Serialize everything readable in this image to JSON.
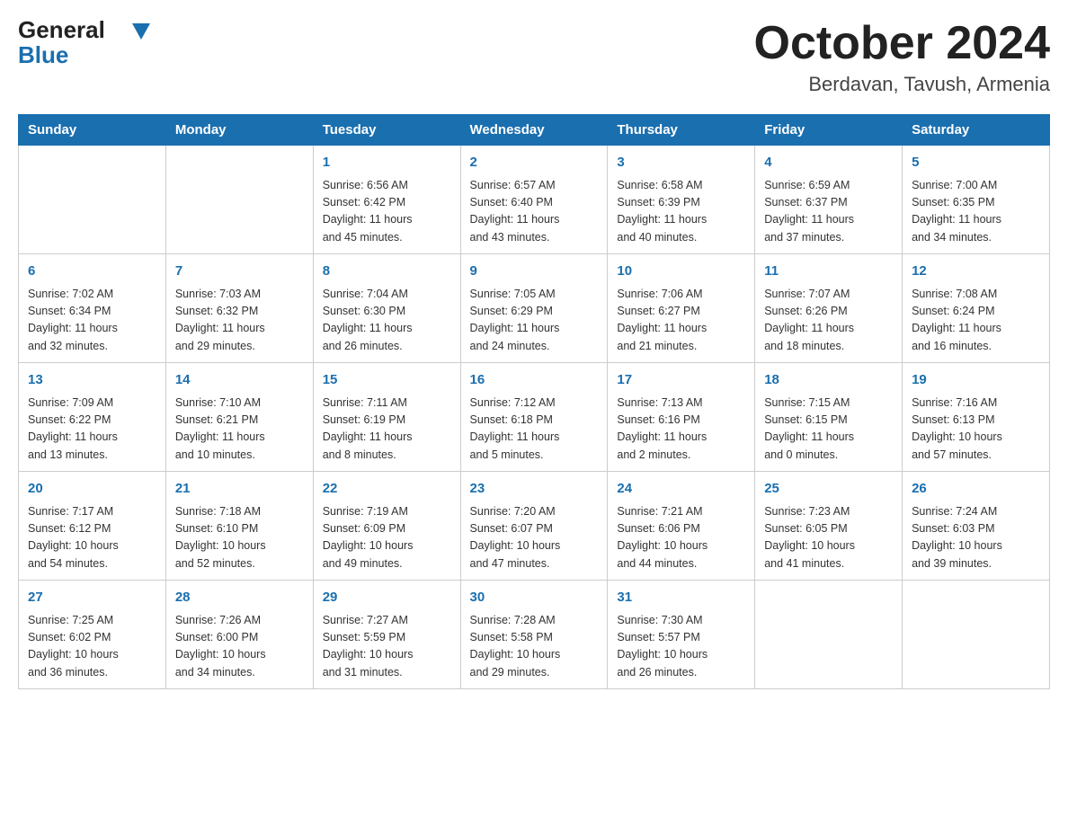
{
  "header": {
    "logo_line1": "General",
    "logo_line2": "Blue",
    "month_title": "October 2024",
    "location": "Berdavan, Tavush, Armenia"
  },
  "weekdays": [
    "Sunday",
    "Monday",
    "Tuesday",
    "Wednesday",
    "Thursday",
    "Friday",
    "Saturday"
  ],
  "weeks": [
    [
      {
        "day": "",
        "info": ""
      },
      {
        "day": "",
        "info": ""
      },
      {
        "day": "1",
        "info": "Sunrise: 6:56 AM\nSunset: 6:42 PM\nDaylight: 11 hours\nand 45 minutes."
      },
      {
        "day": "2",
        "info": "Sunrise: 6:57 AM\nSunset: 6:40 PM\nDaylight: 11 hours\nand 43 minutes."
      },
      {
        "day": "3",
        "info": "Sunrise: 6:58 AM\nSunset: 6:39 PM\nDaylight: 11 hours\nand 40 minutes."
      },
      {
        "day": "4",
        "info": "Sunrise: 6:59 AM\nSunset: 6:37 PM\nDaylight: 11 hours\nand 37 minutes."
      },
      {
        "day": "5",
        "info": "Sunrise: 7:00 AM\nSunset: 6:35 PM\nDaylight: 11 hours\nand 34 minutes."
      }
    ],
    [
      {
        "day": "6",
        "info": "Sunrise: 7:02 AM\nSunset: 6:34 PM\nDaylight: 11 hours\nand 32 minutes."
      },
      {
        "day": "7",
        "info": "Sunrise: 7:03 AM\nSunset: 6:32 PM\nDaylight: 11 hours\nand 29 minutes."
      },
      {
        "day": "8",
        "info": "Sunrise: 7:04 AM\nSunset: 6:30 PM\nDaylight: 11 hours\nand 26 minutes."
      },
      {
        "day": "9",
        "info": "Sunrise: 7:05 AM\nSunset: 6:29 PM\nDaylight: 11 hours\nand 24 minutes."
      },
      {
        "day": "10",
        "info": "Sunrise: 7:06 AM\nSunset: 6:27 PM\nDaylight: 11 hours\nand 21 minutes."
      },
      {
        "day": "11",
        "info": "Sunrise: 7:07 AM\nSunset: 6:26 PM\nDaylight: 11 hours\nand 18 minutes."
      },
      {
        "day": "12",
        "info": "Sunrise: 7:08 AM\nSunset: 6:24 PM\nDaylight: 11 hours\nand 16 minutes."
      }
    ],
    [
      {
        "day": "13",
        "info": "Sunrise: 7:09 AM\nSunset: 6:22 PM\nDaylight: 11 hours\nand 13 minutes."
      },
      {
        "day": "14",
        "info": "Sunrise: 7:10 AM\nSunset: 6:21 PM\nDaylight: 11 hours\nand 10 minutes."
      },
      {
        "day": "15",
        "info": "Sunrise: 7:11 AM\nSunset: 6:19 PM\nDaylight: 11 hours\nand 8 minutes."
      },
      {
        "day": "16",
        "info": "Sunrise: 7:12 AM\nSunset: 6:18 PM\nDaylight: 11 hours\nand 5 minutes."
      },
      {
        "day": "17",
        "info": "Sunrise: 7:13 AM\nSunset: 6:16 PM\nDaylight: 11 hours\nand 2 minutes."
      },
      {
        "day": "18",
        "info": "Sunrise: 7:15 AM\nSunset: 6:15 PM\nDaylight: 11 hours\nand 0 minutes."
      },
      {
        "day": "19",
        "info": "Sunrise: 7:16 AM\nSunset: 6:13 PM\nDaylight: 10 hours\nand 57 minutes."
      }
    ],
    [
      {
        "day": "20",
        "info": "Sunrise: 7:17 AM\nSunset: 6:12 PM\nDaylight: 10 hours\nand 54 minutes."
      },
      {
        "day": "21",
        "info": "Sunrise: 7:18 AM\nSunset: 6:10 PM\nDaylight: 10 hours\nand 52 minutes."
      },
      {
        "day": "22",
        "info": "Sunrise: 7:19 AM\nSunset: 6:09 PM\nDaylight: 10 hours\nand 49 minutes."
      },
      {
        "day": "23",
        "info": "Sunrise: 7:20 AM\nSunset: 6:07 PM\nDaylight: 10 hours\nand 47 minutes."
      },
      {
        "day": "24",
        "info": "Sunrise: 7:21 AM\nSunset: 6:06 PM\nDaylight: 10 hours\nand 44 minutes."
      },
      {
        "day": "25",
        "info": "Sunrise: 7:23 AM\nSunset: 6:05 PM\nDaylight: 10 hours\nand 41 minutes."
      },
      {
        "day": "26",
        "info": "Sunrise: 7:24 AM\nSunset: 6:03 PM\nDaylight: 10 hours\nand 39 minutes."
      }
    ],
    [
      {
        "day": "27",
        "info": "Sunrise: 7:25 AM\nSunset: 6:02 PM\nDaylight: 10 hours\nand 36 minutes."
      },
      {
        "day": "28",
        "info": "Sunrise: 7:26 AM\nSunset: 6:00 PM\nDaylight: 10 hours\nand 34 minutes."
      },
      {
        "day": "29",
        "info": "Sunrise: 7:27 AM\nSunset: 5:59 PM\nDaylight: 10 hours\nand 31 minutes."
      },
      {
        "day": "30",
        "info": "Sunrise: 7:28 AM\nSunset: 5:58 PM\nDaylight: 10 hours\nand 29 minutes."
      },
      {
        "day": "31",
        "info": "Sunrise: 7:30 AM\nSunset: 5:57 PM\nDaylight: 10 hours\nand 26 minutes."
      },
      {
        "day": "",
        "info": ""
      },
      {
        "day": "",
        "info": ""
      }
    ]
  ]
}
